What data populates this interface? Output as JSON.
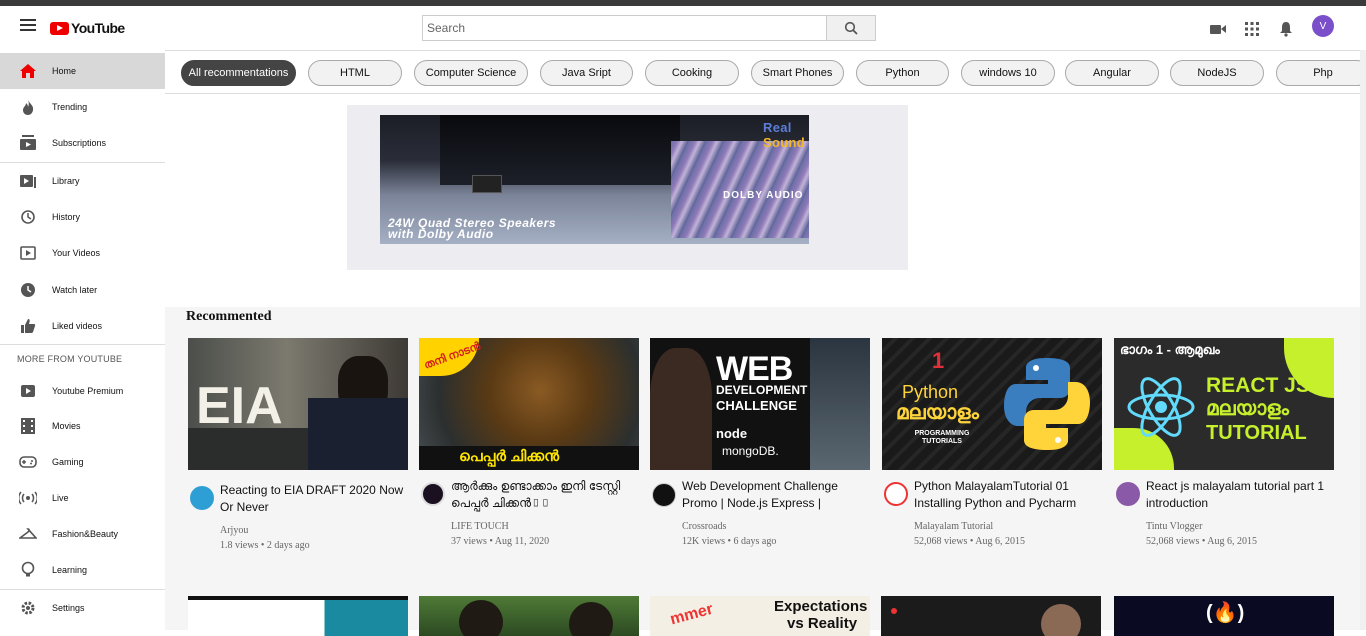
{
  "header": {
    "logo_text": "YouTube",
    "search_placeholder": "Search",
    "avatar_letter": "V"
  },
  "sidebar": {
    "items": [
      {
        "label": "Home",
        "icon": "home-icon"
      },
      {
        "label": "Trending",
        "icon": "fire-icon"
      },
      {
        "label": "Subscriptions",
        "icon": "subscriptions-icon"
      },
      {
        "label": "Library",
        "icon": "library-icon"
      },
      {
        "label": "History",
        "icon": "history-icon"
      },
      {
        "label": "Your Videos",
        "icon": "video-icon"
      },
      {
        "label": "Watch later",
        "icon": "clock-icon"
      },
      {
        "label": "Liked videos",
        "icon": "thumbs-up-icon"
      }
    ],
    "more_heading": "MORE FROM YOUTUBE",
    "more_items": [
      {
        "label": "Youtube Premium",
        "icon": "premium-icon"
      },
      {
        "label": "Movies",
        "icon": "film-icon"
      },
      {
        "label": "Gaming",
        "icon": "gamepad-icon"
      },
      {
        "label": "Live",
        "icon": "live-icon"
      },
      {
        "label": "Fashion&Beauty",
        "icon": "hanger-icon"
      },
      {
        "label": "Learning",
        "icon": "lightbulb-icon"
      }
    ],
    "settings_label": "Settings"
  },
  "chips": [
    "All recommentations",
    "HTML",
    "Computer Science",
    "Java Sript",
    "Cooking",
    "Smart Phones",
    "Python",
    "windows 10",
    "Angular",
    "NodeJS",
    "Php"
  ],
  "ad": {
    "brand_a": "Real",
    "brand_b": "Sound",
    "dolby": "DOLBY AUDIO",
    "caption_line1": "24W Quad Stereo Speakers",
    "caption_line2": "with Dolby Audio"
  },
  "feed": {
    "section_title": "Recommented",
    "videos": [
      {
        "title": "Reacting to EIA DRAFT 2020 Now Or Never",
        "channel": "Arjyou",
        "stats": "1.8 views • 2 days ago",
        "thumb_text": "EIA"
      },
      {
        "title": "ആർക്കും ഉണ്ടാക്കാം ഇനി ടേസ്റ്റി പെപ്പർ ചിക്കൻ▯▯",
        "channel": "LIFE TOUCH",
        "stats": "37 views • Aug 11, 2020",
        "thumb_text": "പെപ്പർ ചിക്കൻ",
        "thumb_badge": "തനി നാടൻ"
      },
      {
        "title": "Web Development Challenge Promo | Node.js Express |",
        "channel": "Crossroads",
        "stats": "12K views • 6 days ago",
        "thumb_text": "WEB",
        "thumb_sub1": "DEVELOPMENT",
        "thumb_sub2": "CHALLENGE",
        "thumb_node": "node",
        "thumb_mongo": "mongoDB."
      },
      {
        "title": "Python MalayalamTutorial 01 Installing Python and Pycharm",
        "channel": "Malayalam Tutorial",
        "stats": "52,068 views • Aug 6, 2015",
        "thumb_num": "1",
        "thumb_text": "Python",
        "thumb_sub1": "മലയാളം",
        "thumb_sub2": "PROGRAMMING TUTORIALS"
      },
      {
        "title": "React js malayalam tutorial part 1 introduction",
        "channel": "Tintu Vlogger",
        "stats": "52,068 views • Aug 6, 2015",
        "thumb_badge": "ഭാഗം 1 - ആമുഖം",
        "thumb_text": "REACT JS",
        "thumb_sub1": "മലയാളം",
        "thumb_sub2": "TUTORIAL"
      }
    ],
    "row2_text_a": "Expectations",
    "row2_text_b": "vs Reality",
    "row2_text_c": "mmer"
  },
  "colors": {
    "brand_red": "#e00000",
    "chip_active": "#444444",
    "avatar_bg": "#7b4fc9"
  }
}
